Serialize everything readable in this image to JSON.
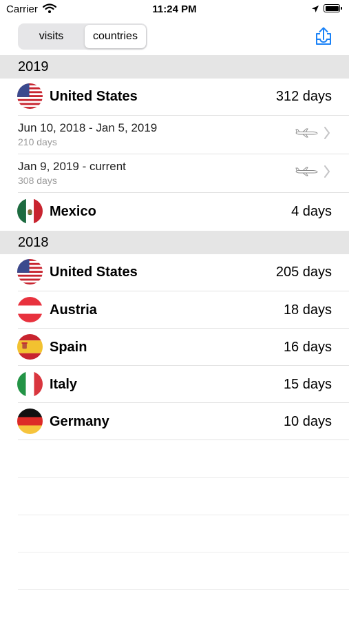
{
  "status_bar": {
    "carrier": "Carrier",
    "time": "11:24 PM"
  },
  "segmented": {
    "visits_label": "visits",
    "countries_label": "countries",
    "selected": "countries"
  },
  "sections": [
    {
      "year": "2019",
      "rows": [
        {
          "country": "United States",
          "days": "312 days",
          "flag": "us-flag"
        },
        {
          "dates": "Jun 10, 2018 - Jan 5, 2019",
          "duration": "210 days"
        },
        {
          "dates": "Jan 9, 2019 - current",
          "duration": "308 days"
        },
        {
          "country": "Mexico",
          "days": "4 days",
          "flag": "mexico-flag"
        }
      ]
    },
    {
      "year": "2018",
      "rows": [
        {
          "country": "United States",
          "days": "205 days",
          "flag": "us-flag"
        },
        {
          "country": "Austria",
          "days": "18 days",
          "flag": "austria-flag"
        },
        {
          "country": "Spain",
          "days": "16 days",
          "flag": "spain-flag"
        },
        {
          "country": "Italy",
          "days": "15 days",
          "flag": "italy-flag"
        },
        {
          "country": "Germany",
          "days": "10 days",
          "flag": "germany-flag"
        }
      ]
    }
  ],
  "colors": {
    "accent": "#1a82f7",
    "section_bg": "#e5e5e5",
    "secondary_text": "#9a9a9a"
  }
}
